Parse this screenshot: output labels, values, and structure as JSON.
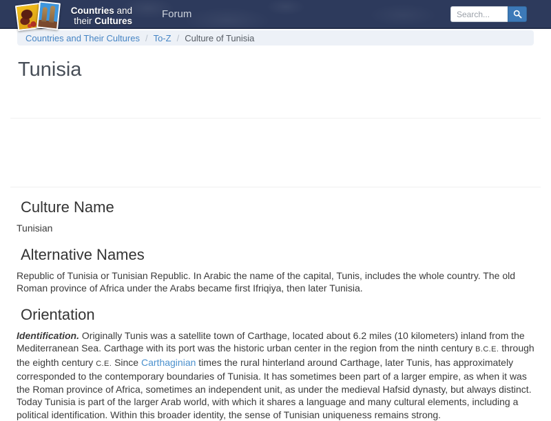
{
  "navbar": {
    "logo": {
      "line1_bold": "Countries",
      "line1_rest": " and",
      "line2_rest": "their ",
      "line2_bold": "Cultures"
    },
    "forum_label": "Forum",
    "search": {
      "placeholder": "Search...",
      "button_icon": "magnifier-icon"
    }
  },
  "breadcrumb": {
    "separator": "/",
    "items": [
      {
        "label": "Countries and Their Cultures"
      },
      {
        "label": "To-Z"
      },
      {
        "label": "Culture of Tunisia"
      }
    ]
  },
  "page": {
    "title": "Tunisia"
  },
  "sections": {
    "culture_name": {
      "heading": "Culture Name",
      "body": "Tunisian"
    },
    "alternative_names": {
      "heading": "Alternative Names",
      "body": "Republic of Tunisia or Tunisian Republic. In Arabic the name of the capital, Tunis, includes the whole country. The old Roman province of Africa under the Arabs became first Ifriqiya, then later Tunisia."
    },
    "orientation": {
      "heading": "Orientation",
      "lead": "Identification.",
      "seg1": " Originally Tunis was a satellite town of Carthage, located about 6.2 miles (10 kilometers) inland from the Mediterranean Sea. Carthage with its port was the historic urban center in the region from the ninth century ",
      "era1": "B.C.E.",
      "seg2": " through the eighth century ",
      "era2": "C.E.",
      "seg3": " Since ",
      "link_label": "Carthaginian",
      "seg4": " times the rural hinterland around Carthage, later Tunis, has approximately corresponded to the contemporary boundaries of Tunisia. It has sometimes been part of a larger empire, as when it was the Roman province of Africa, sometimes an independent unit, as under the medieval Hafsid dynasty, but always distinct. Today Tunisia is part of the larger Arab world, with which it shares a language and many cultural elements, including a political identification. Within this broader identity, the sense of Tunisian uniqueness remains strong."
    }
  },
  "colors": {
    "navbar_bg": "#2d3a5c",
    "search_button_blue": "#3c79b8",
    "breadcrumb_bg": "#edf1f7",
    "link_blue": "#4584c4",
    "inline_link_blue": "#4a90cd",
    "title_gray": "#474e57"
  }
}
